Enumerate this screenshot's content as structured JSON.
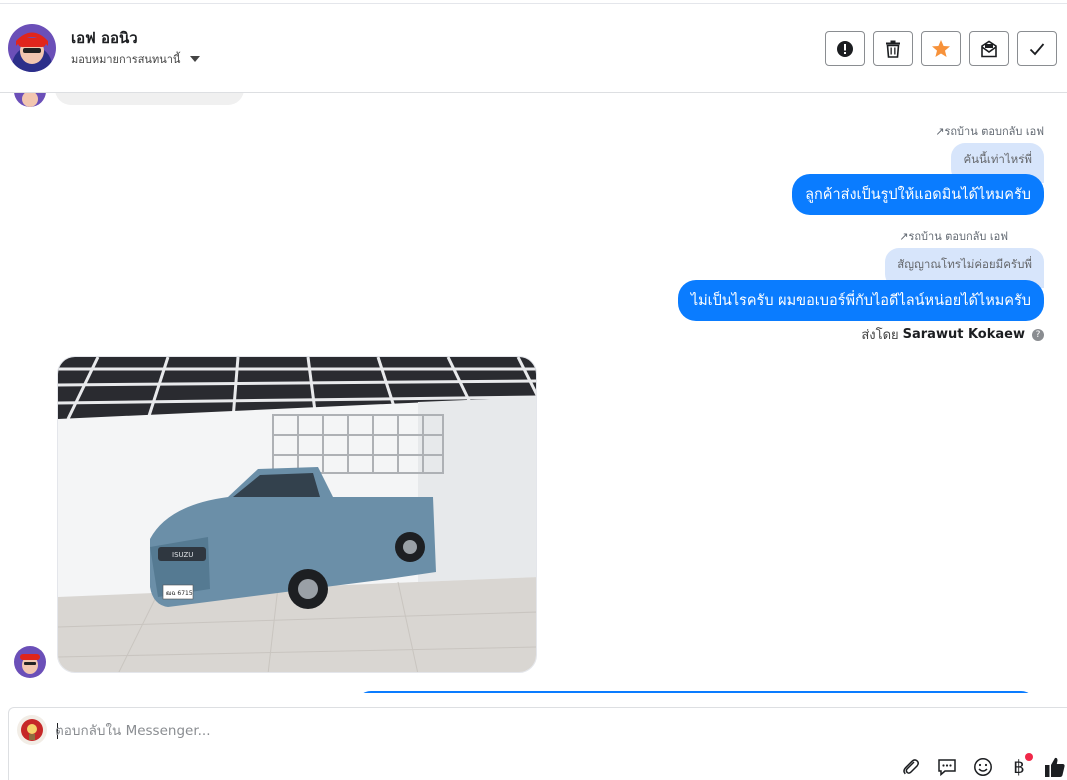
{
  "header": {
    "contact_name": "เอฟ ออนิว",
    "assign_label": "มอบหมายการสนทนานี้",
    "actions": [
      {
        "name": "spam-icon"
      },
      {
        "name": "trash-icon"
      },
      {
        "name": "star-icon"
      },
      {
        "name": "mark-unread-icon"
      },
      {
        "name": "check-icon"
      }
    ],
    "star_color": "#f7923a"
  },
  "conversation": {
    "messages": [
      {
        "reply_note": "รถบ้าน ตอบกลับ เอฟ",
        "quoted_text": "คันนี้เท่าไหร่พี่",
        "text": "ลูกค้าส่งเป็นรูปให้แอดมินได้ไหมครับ"
      },
      {
        "reply_note": "รถบ้าน ตอบกลับ เอฟ",
        "quoted_text": "สัญญาณโทรไม่ค่อยมีครับพี่",
        "text": "ไม่เป็นไรครับ ผมขอเบอร์พี่กับไอดีไลน์หน่อยได้ไหมครับ"
      }
    ],
    "sent_by_prefix": "ส่งโดย",
    "sent_by_name": "Sarawut Kokaew",
    "photo": {
      "plate_text": "ฒฉ 6715",
      "brand_text": "ISUZU"
    },
    "bubble_color": "#0a7cff",
    "quote_color": "#d7e5fb"
  },
  "composer": {
    "placeholder": "ตอบกลับใน Messenger...",
    "tools": [
      "attach-icon",
      "saved-reply-icon",
      "emoji-icon",
      "currency-icon",
      "like-icon"
    ],
    "currency_symbol": "฿",
    "like_color": "#1c1e21"
  }
}
